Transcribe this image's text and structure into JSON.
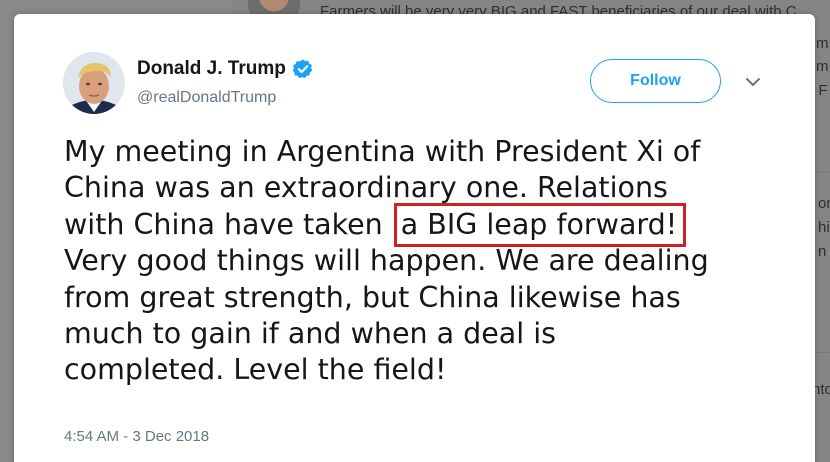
{
  "background": {
    "rows": [
      {
        "text": "Farmers will be very very BIG and FAST beneficiaries of our deal with C"
      },
      {
        "text": "m"
      },
      {
        "text": "m"
      },
      {
        "text": ". F"
      },
      {
        "text": "or"
      },
      {
        "text": "hi"
      },
      {
        "text": "n t"
      },
      {
        "text": "nto"
      }
    ]
  },
  "tweet": {
    "author_name": "Donald J. Trump",
    "author_handle": "@realDonaldTrump",
    "follow_label": "Follow",
    "text_lines": [
      "My meeting in Argentina with President Xi of",
      "China was an extraordinary one. Relations",
      "with China have taken ",
      "a BIG leap forward!",
      "Very good things will happen. We are dealing",
      "from great strength, but China likewise has",
      "much to gain if and when a deal is",
      "completed. Level the field!"
    ],
    "timestamp": "4:54 AM - 3 Dec 2018",
    "verified_icon": "verified-badge-icon",
    "caret_icon": "chevron-down-icon",
    "highlight_color": "#d11f26",
    "accent_color": "#1da1f2"
  }
}
